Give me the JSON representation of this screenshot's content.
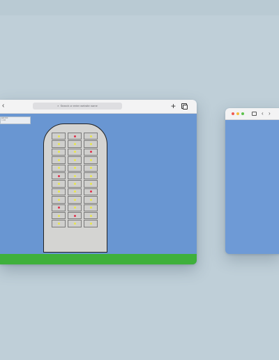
{
  "desktop": {
    "background": "#bfcfd8"
  },
  "main_window": {
    "address_bar": {
      "placeholder": "Search or enter website name",
      "search_glyph": "⌕"
    },
    "toolbar": {
      "back": "‹",
      "new_tab": "+"
    },
    "hud": {
      "lines": [
        "L3 ===",
        "> =="
      ]
    },
    "colors": {
      "sky": "#6996d2",
      "ground": "#3fb03c",
      "tower": "#d4d4d2"
    },
    "tower": {
      "rows": [
        [
          "yellow",
          "red",
          "yellow"
        ],
        [
          "yellow",
          "yellow",
          "yellow"
        ],
        [
          "yellow",
          "yellow",
          "red"
        ],
        [
          "yellow",
          "yellow",
          "yellow"
        ],
        [
          "yellow",
          "yellow",
          "yellow"
        ],
        [
          "red",
          "yellow",
          "yellow"
        ],
        [
          "yellow",
          "yellow",
          "yellow"
        ],
        [
          "yellow",
          "yellow",
          "red"
        ],
        [
          "yellow",
          "yellow",
          "yellow"
        ],
        [
          "red",
          "yellow",
          "yellow"
        ],
        [
          "yellow",
          "red",
          "yellow"
        ],
        [
          "yellow",
          "yellow",
          "yellow"
        ]
      ],
      "light_colors": {
        "yellow": "#e8e64a",
        "red": "#e0304a"
      }
    }
  },
  "second_window": {
    "traffic_lights": [
      "#ee5a52",
      "#f5bd3b",
      "#5dc24d"
    ],
    "nav": {
      "back": "‹",
      "forward": "›"
    }
  }
}
